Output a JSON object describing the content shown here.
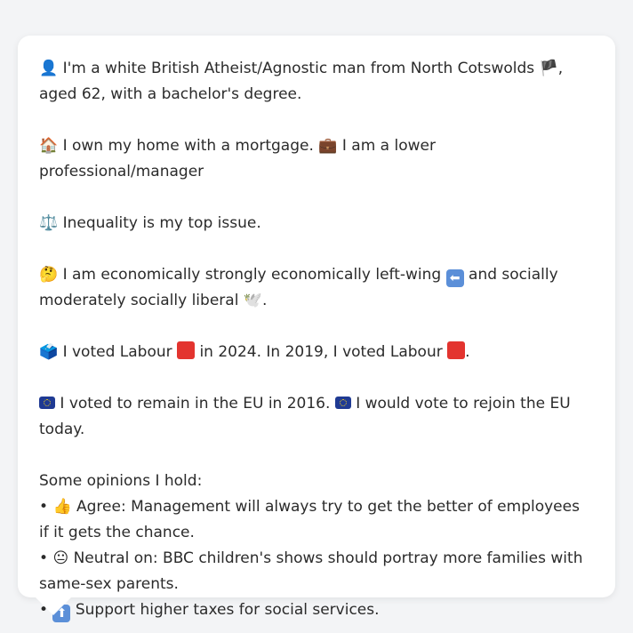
{
  "profile": {
    "intro": {
      "icon": "person-silhouette-icon",
      "text_a": "I'm a white British Atheist/Agnostic man from North Cotswolds",
      "flag_icon": "england-flag-icon",
      "text_b": ", aged 62, with a bachelor's degree."
    },
    "home": {
      "home_icon": "house-icon",
      "text_a": "I own my home with a mortgage.",
      "work_icon": "briefcase-icon",
      "text_b": "I am a lower professional/manager"
    },
    "issue": {
      "icon": "scales-icon",
      "text": "Inequality is my top issue."
    },
    "ideology": {
      "icon": "thinking-face-icon",
      "text_a": "I am economically strongly economically left-wing",
      "left_icon": "left-arrow-icon",
      "text_b": "and socially moderately socially liberal",
      "dove_icon": "dove-icon",
      "text_c": "."
    },
    "votes": {
      "icon": "ballot-box-icon",
      "text_a": "I voted Labour",
      "party_color": "#e3342f",
      "text_b": "in 2024. In 2019, I voted Labour",
      "text_c": "."
    },
    "eu": {
      "icon": "eu-flag-icon",
      "text_a": "I voted to remain in the EU in 2016.",
      "text_b": "I would vote to rejoin the EU today."
    },
    "opinions": {
      "heading": "Some opinions I hold:",
      "bullet": "•",
      "items": [
        {
          "icon": "thumbs-up-icon",
          "text": "Agree: Management will always try to get the better of employees if it gets the chance."
        },
        {
          "icon": "neutral-face-icon",
          "text": "Neutral on: BBC children's shows should portray more families with same-sex parents."
        },
        {
          "icon": "up-arrow-icon",
          "text": "Support higher taxes for social services."
        }
      ]
    }
  }
}
